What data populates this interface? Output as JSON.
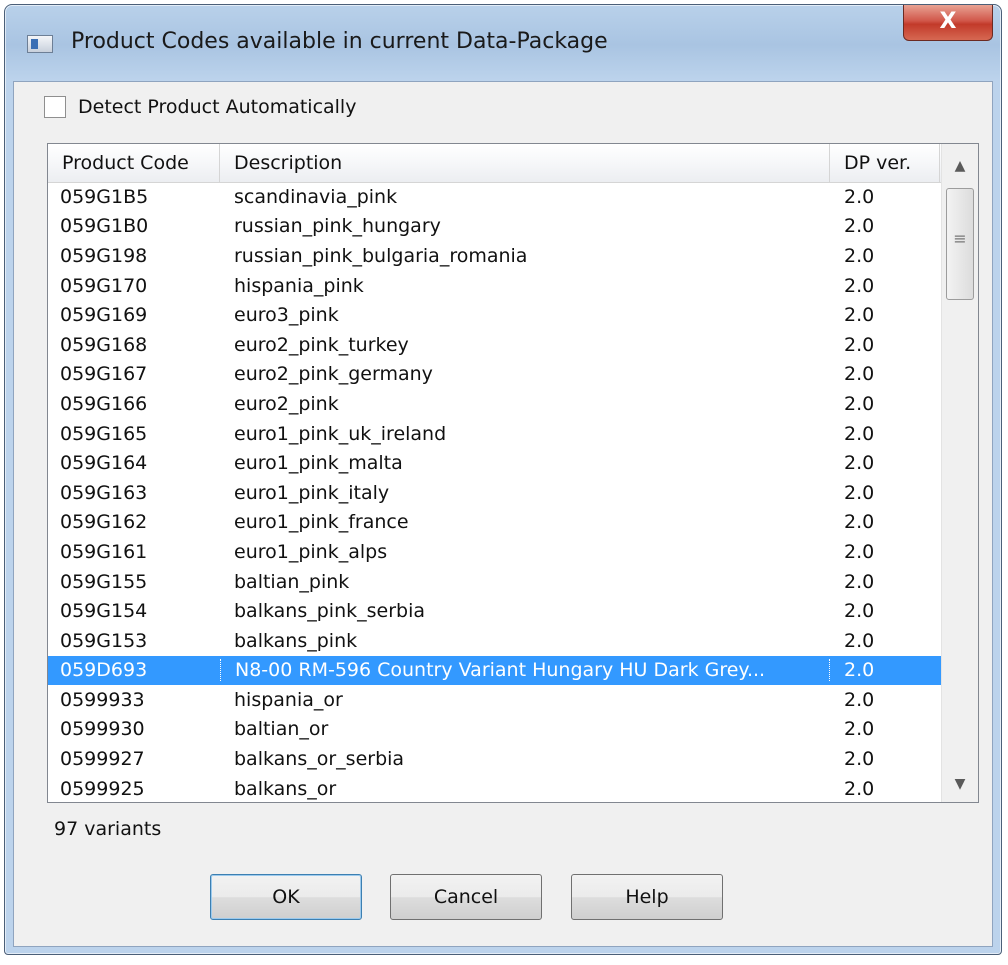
{
  "window": {
    "title": "Product Codes available in current Data-Package",
    "close_glyph": "X"
  },
  "options": {
    "detect_label": "Detect Product Automatically",
    "detect_checked": false
  },
  "table": {
    "headers": [
      "Product Code",
      "Description",
      "DP ver."
    ],
    "rows": [
      {
        "code": "059G1B5",
        "desc": "scandinavia_pink",
        "ver": "2.0"
      },
      {
        "code": "059G1B0",
        "desc": "russian_pink_hungary",
        "ver": "2.0"
      },
      {
        "code": "059G198",
        "desc": "russian_pink_bulgaria_romania",
        "ver": "2.0"
      },
      {
        "code": "059G170",
        "desc": "hispania_pink",
        "ver": "2.0"
      },
      {
        "code": "059G169",
        "desc": "euro3_pink",
        "ver": "2.0"
      },
      {
        "code": "059G168",
        "desc": "euro2_pink_turkey",
        "ver": "2.0"
      },
      {
        "code": "059G167",
        "desc": "euro2_pink_germany",
        "ver": "2.0"
      },
      {
        "code": "059G166",
        "desc": "euro2_pink",
        "ver": "2.0"
      },
      {
        "code": "059G165",
        "desc": "euro1_pink_uk_ireland",
        "ver": "2.0"
      },
      {
        "code": "059G164",
        "desc": "euro1_pink_malta",
        "ver": "2.0"
      },
      {
        "code": "059G163",
        "desc": "euro1_pink_italy",
        "ver": "2.0"
      },
      {
        "code": "059G162",
        "desc": "euro1_pink_france",
        "ver": "2.0"
      },
      {
        "code": "059G161",
        "desc": "euro1_pink_alps",
        "ver": "2.0"
      },
      {
        "code": "059G155",
        "desc": "baltian_pink",
        "ver": "2.0"
      },
      {
        "code": "059G154",
        "desc": "balkans_pink_serbia",
        "ver": "2.0"
      },
      {
        "code": "059G153",
        "desc": "balkans_pink",
        "ver": "2.0"
      },
      {
        "code": "059D693",
        "desc": "N8-00 RM-596 Country Variant Hungary HU Dark Grey...",
        "ver": "2.0",
        "selected": true
      },
      {
        "code": "0599933",
        "desc": "hispania_or",
        "ver": "2.0"
      },
      {
        "code": "0599930",
        "desc": "baltian_or",
        "ver": "2.0"
      },
      {
        "code": "0599927",
        "desc": "balkans_or_serbia",
        "ver": "2.0"
      },
      {
        "code": "0599925",
        "desc": "balkans_or",
        "ver": "2.0"
      }
    ]
  },
  "status": {
    "count_text": "97 variants"
  },
  "buttons": {
    "ok": "OK",
    "cancel": "Cancel",
    "help": "Help"
  },
  "colors": {
    "selection": "#3399ff",
    "dialog_bg": "#f0f0f0",
    "close_button": "#c23a2a"
  }
}
